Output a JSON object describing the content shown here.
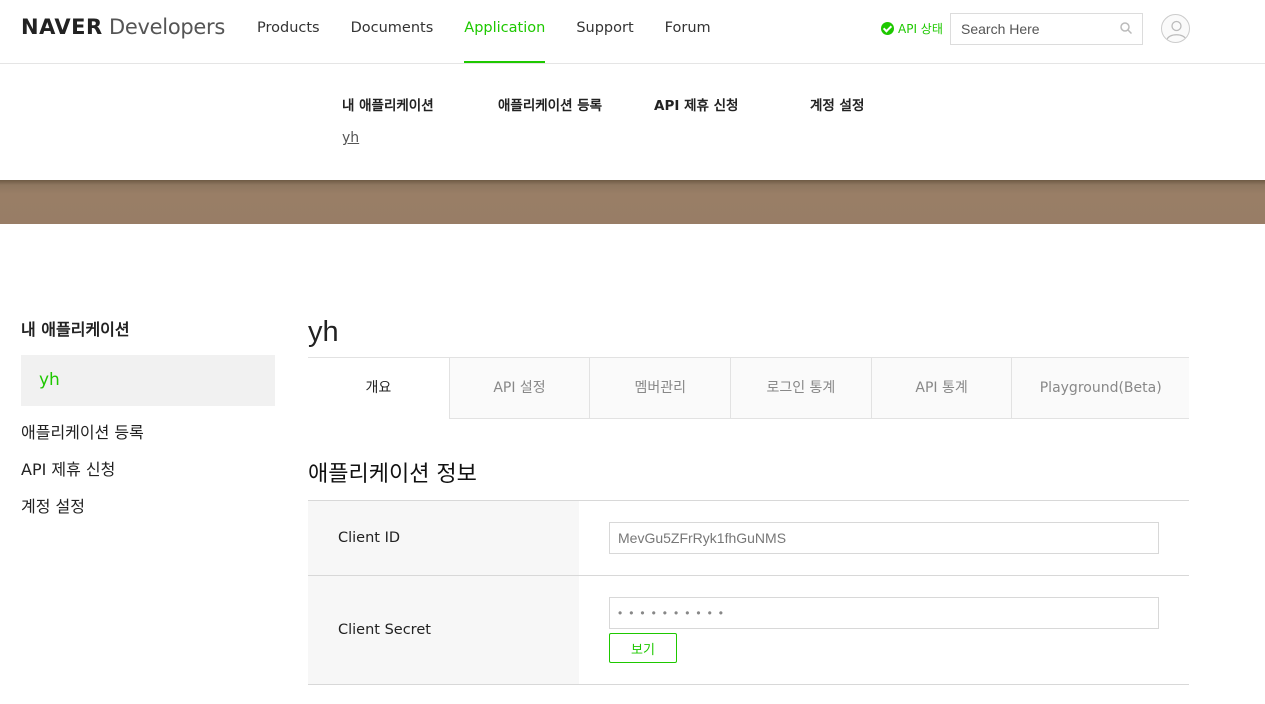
{
  "logo": {
    "bold": "NAVER",
    "light": " Developers"
  },
  "header": {
    "nav": [
      "Products",
      "Documents",
      "Application",
      "Support",
      "Forum"
    ],
    "active_nav": "Application",
    "api_status": "API 상태",
    "search_placeholder": "Search Here",
    "accent_color": "#1ec800"
  },
  "subnav": {
    "items": [
      "내 애플리케이션",
      "애플리케이션 등록",
      "API 제휴 신청",
      "계정 설정"
    ],
    "sub_item": "yh"
  },
  "sidebar": {
    "title": "내 애플리케이션",
    "active_item": "yh",
    "items": [
      "애플리케이션 등록",
      "API 제휴 신청",
      "계정 설정"
    ]
  },
  "main": {
    "app_name": "yh",
    "tabs": [
      "개요",
      "API 설정",
      "멤버관리",
      "로그인 통계",
      "API 통계",
      "Playground(Beta)"
    ],
    "active_tab": "개요",
    "section_title": "애플리케이션 정보",
    "client_id_label": "Client ID",
    "client_id_value": "MevGu5ZFrRyk1fhGuNMS",
    "client_secret_label": "Client Secret",
    "client_secret_value": "••••••••••",
    "view_button": "보기"
  }
}
